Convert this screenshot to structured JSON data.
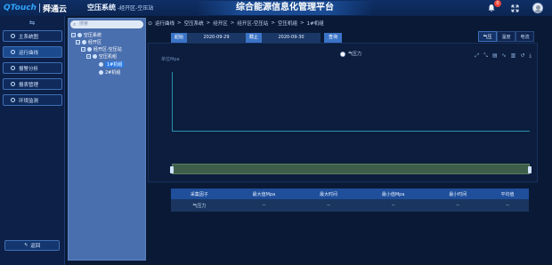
{
  "header": {
    "logo_q": "QTouch",
    "logo_cn": "舜通云",
    "system": "空压系统",
    "system_sub": "-经开区-空压站",
    "platform": "综合能源信息化管理平台",
    "notification_count": "0",
    "icons": [
      "bell-icon",
      "fullscreen-icon",
      "avatar"
    ]
  },
  "sidebar": {
    "items": [
      {
        "label": "主系统图",
        "active": false
      },
      {
        "label": "运行曲线",
        "active": true
      },
      {
        "label": "报警分析",
        "active": false
      },
      {
        "label": "报表管理",
        "active": false
      },
      {
        "label": "环境监测",
        "active": false
      }
    ],
    "back_label": "返回"
  },
  "tree": {
    "search_placeholder": "搜索",
    "nodes": [
      {
        "label": "空压系统",
        "selected": false
      },
      {
        "label": "经开区",
        "selected": false
      },
      {
        "label": "经开区-空压站",
        "selected": false
      },
      {
        "label": "空压机组",
        "selected": false
      },
      {
        "label": "1#机组",
        "selected": true
      },
      {
        "label": "2#机组",
        "selected": false
      }
    ]
  },
  "breadcrumb": [
    "运行曲线",
    "空压系统",
    "经开区",
    "经开区-空压站",
    "空压机组",
    "1#机组"
  ],
  "filter": {
    "start_label": "起始",
    "start_date": "2020-09-29",
    "end_label": "截止",
    "end_date": "2020-09-30",
    "query_label": "查询"
  },
  "tabs": [
    {
      "label": "气压",
      "active": true
    },
    {
      "label": "温度",
      "active": false
    },
    {
      "label": "电流",
      "active": false
    }
  ],
  "chart_data": {
    "type": "line",
    "unit": "单位Mpa",
    "series": [
      {
        "name": "气压力",
        "values": []
      }
    ]
  },
  "table": {
    "headers": [
      "采集因子",
      "最大值Mpa",
      "最大时间",
      "最小值Mpa",
      "最小时间",
      "平均值"
    ],
    "rows": [
      [
        "气压力",
        "--",
        "--",
        "--",
        "--",
        "--"
      ]
    ]
  }
}
